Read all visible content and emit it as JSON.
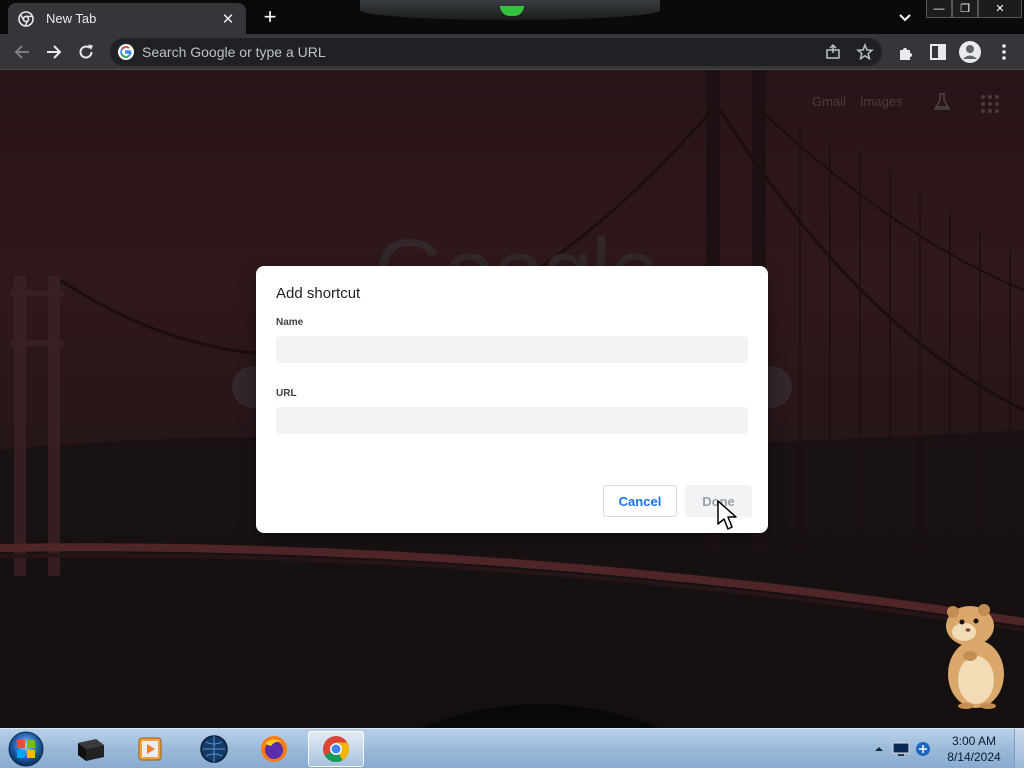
{
  "tab": {
    "title": "New Tab",
    "close_glyph": "✕"
  },
  "tabstrip": {
    "new_tab_glyph": "+",
    "tab_search_icon": "chevron-down-icon"
  },
  "window_controls": {
    "minimize": "—",
    "maximize": "❐",
    "close": "✕"
  },
  "toolbar": {
    "omnibox_placeholder": "Search Google or type a URL",
    "icons": [
      "back-icon",
      "forward-icon",
      "reload-icon",
      "share-icon",
      "star-icon",
      "extensions-icon",
      "side-panel-icon",
      "profile-icon",
      "menu-icon"
    ]
  },
  "ntp": {
    "links": [
      "Gmail",
      "Images"
    ],
    "logo_text": "Google"
  },
  "dialog": {
    "title": "Add shortcut",
    "name_label": "Name",
    "name_value": "",
    "url_label": "URL",
    "url_value": "",
    "cancel_label": "Cancel",
    "done_label": "Done",
    "done_enabled": false
  },
  "taskbar": {
    "apps": [
      "virtualbox-app",
      "media-player-app",
      "network-app",
      "firefox-app",
      "chrome-app"
    ],
    "active_app": "chrome-app",
    "clock_time": "3:00 AM",
    "clock_date": "8/14/2024"
  },
  "colors": {
    "accent": "#1a73e8",
    "tab_bg": "#35363a",
    "frame_bg": "#0a0a0b"
  }
}
